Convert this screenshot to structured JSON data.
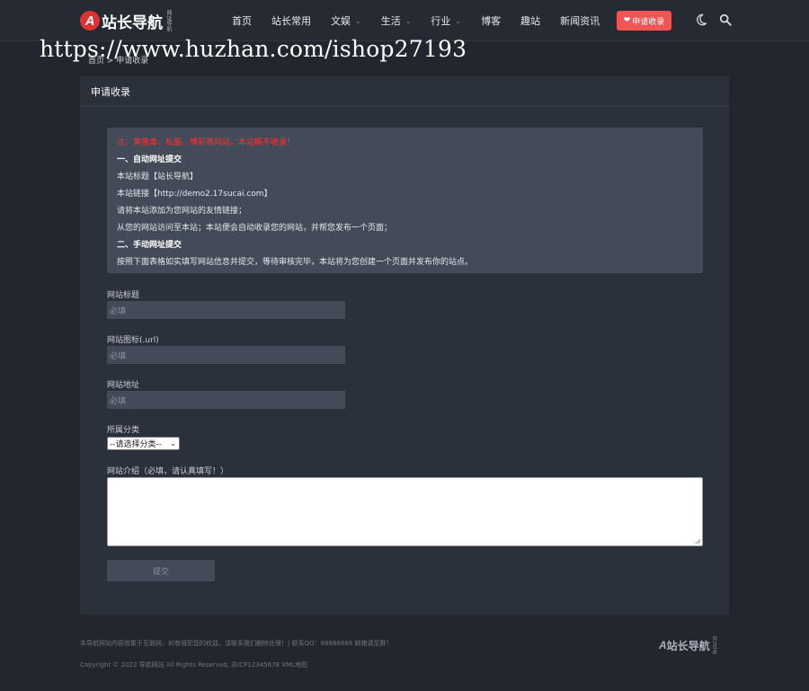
{
  "header": {
    "logo_mark": "A",
    "logo_text": "站长导航",
    "logo_sub": "网址导航",
    "nav": [
      {
        "label": "首页",
        "has_dropdown": false
      },
      {
        "label": "站长常用",
        "has_dropdown": false
      },
      {
        "label": "文娱",
        "has_dropdown": true
      },
      {
        "label": "生活",
        "has_dropdown": true
      },
      {
        "label": "行业",
        "has_dropdown": true
      },
      {
        "label": "博客",
        "has_dropdown": false
      },
      {
        "label": "趣站",
        "has_dropdown": false
      },
      {
        "label": "新闻资讯",
        "has_dropdown": false
      }
    ],
    "apply_button": "申请收录",
    "dropdown_icon": "chevron-down-icon",
    "apply_icon": "heart-icon",
    "theme_icon": "moon-icon",
    "search_icon": "search-icon"
  },
  "watermark": "https://www.huzhan.com/ishop27193",
  "breadcrumb": "首页 > 申请收录",
  "card": {
    "title": "申请收录",
    "notice": {
      "warning": "注：黄赌毒、私服、博彩等网站，本站概不收录！",
      "section1_title": "一、自动网址提交",
      "line1": "本站标题【站长导航】",
      "line2": "本站链接【http://demo2.17sucai.com】",
      "line3": "请将本站添加为您网站的友情链接；",
      "line4": "从您的网站访问至本站；本站便会自动收录您的网站，并帮您发布一个页面；",
      "section2_title": "二、手动网址提交",
      "line5": "按照下面表格如实填写网站信息并提交，等待审核完毕，本站将为您创建一个页面并发布你的站点。"
    },
    "form": {
      "title_label": "网站标题",
      "title_placeholder": "必填",
      "icon_label": "网站图标(.url)",
      "icon_placeholder": "必填",
      "url_label": "网站地址",
      "url_placeholder": "必填",
      "category_label": "所属分类",
      "category_selected": "--请选择分类--",
      "intro_label": "网站介绍（必填，请认真填写！）",
      "submit_label": "提交"
    }
  },
  "footer": {
    "line1": "本导航网站内容收集于互联网，如有侵犯您的权益，请联系我们删除处理！| 联系QQ：88888888 邮箱请至群！",
    "line2": "Copyright © 2022 导航网站 All Rights Reserved. 苏ICP12345678 XML地图",
    "logo_mark": "A",
    "logo_text": "站长导航",
    "logo_sub": "网址导航"
  }
}
